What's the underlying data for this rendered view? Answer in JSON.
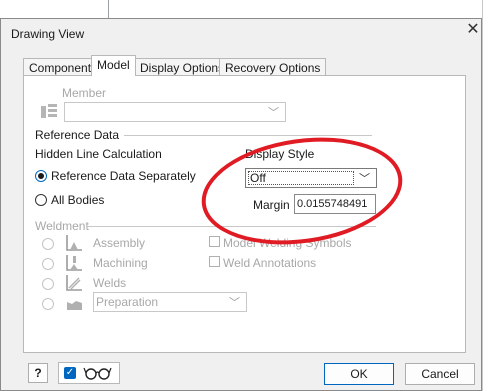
{
  "window": {
    "title": "Drawing View",
    "close_glyph": "✕"
  },
  "tabs": [
    {
      "label": "Component",
      "active": false
    },
    {
      "label": "Model",
      "active": true
    },
    {
      "label": "Display Options",
      "active": false
    },
    {
      "label": "Recovery Options",
      "active": false
    }
  ],
  "member": {
    "label": "Member",
    "value": ""
  },
  "reference_data": {
    "section_label": "Reference Data",
    "hidden_line_label": "Hidden Line Calculation",
    "option_separately": "Reference Data Separately",
    "option_all_bodies": "All Bodies",
    "selected_option": "Reference Data Separately",
    "display_style_label": "Display Style",
    "display_style_value": "Off",
    "margin_label": "Margin",
    "margin_value": "0.0155748491"
  },
  "weldment": {
    "section_label": "Weldment",
    "options": [
      "Assembly",
      "Machining",
      "Welds"
    ],
    "preparation_value": "Preparation",
    "model_welding_symbols_label": "Model Welding Symbols",
    "weld_annotations_label": "Weld Annotations"
  },
  "footer": {
    "ok_label": "OK",
    "cancel_label": "Cancel",
    "help_glyph": "?"
  },
  "colors": {
    "accent": "#0067c0",
    "annotation": "#e01b24"
  }
}
